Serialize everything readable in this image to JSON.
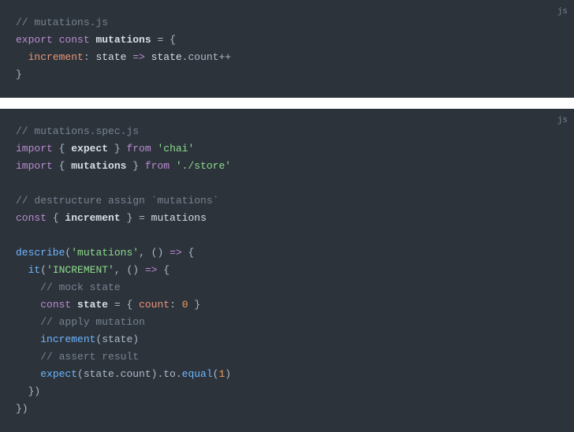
{
  "block1": {
    "lang": "js",
    "l1": "// mutations.js",
    "l2_export": "export",
    "l2_const": "const",
    "l2_name": "mutations",
    "l2_eqbrace": " = {",
    "l3_prop": "increment",
    "l3_colon": ":",
    "l3_state": " state ",
    "l3_arrow": "=>",
    "l3_state2": " state",
    "l3_dotcount": ".count++",
    "l4": "}"
  },
  "block2": {
    "lang": "js",
    "l1": "// mutations.spec.js",
    "l2_import": "import",
    "l2_brace_l": " { ",
    "l2_expect": "expect",
    "l2_brace_r": " } ",
    "l2_from": "from",
    "l2_chai": "'chai'",
    "l3_import": "import",
    "l3_brace_l": " { ",
    "l3_mut": "mutations",
    "l3_brace_r": " } ",
    "l3_from": "from",
    "l3_store": "'./store'",
    "l5": "// destructure assign `mutations`",
    "l6_const": "const",
    "l6_brace_l": " { ",
    "l6_inc": "increment",
    "l6_brace_r": " } = ",
    "l6_mut": "mutations",
    "l8_describe": "describe",
    "l8_paren": "(",
    "l8_str": "'mutations'",
    "l8_comma": ", () ",
    "l8_arrow": "=>",
    "l8_brace": " {",
    "l9_it": "it",
    "l9_paren": "(",
    "l9_str": "'INCREMENT'",
    "l9_comma": ", () ",
    "l9_arrow": "=>",
    "l9_brace": " {",
    "l10": "// mock state",
    "l11_const": "const",
    "l11_state": " state ",
    "l11_eq": "=",
    "l11_brace_l": " { ",
    "l11_count": "count",
    "l11_colon": ":",
    "l11_zero": "0",
    "l11_brace_r": " }",
    "l12": "// apply mutation",
    "l13_inc": "increment",
    "l13_call": "(state)",
    "l14": "// assert result",
    "l15_expect": "expect",
    "l15_open": "(state.count).to.",
    "l15_equal": "equal",
    "l15_paren": "(",
    "l15_one": "1",
    "l15_close": ")",
    "l16": "  })",
    "l17": "})"
  }
}
